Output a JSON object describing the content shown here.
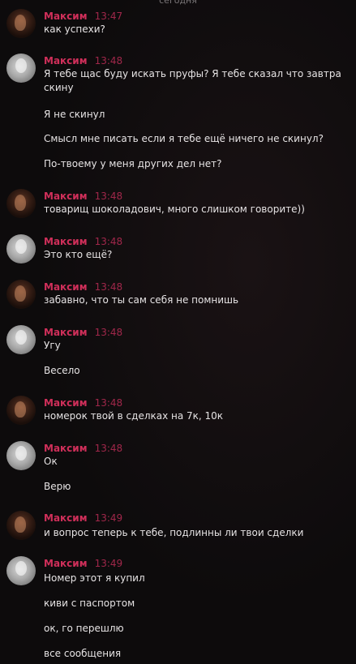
{
  "date_separator": "сегодня",
  "colors": {
    "author": "#d02f5a",
    "time": "#a0274a",
    "text": "#e6e3e4",
    "background": "#0d0b0c"
  },
  "messages": [
    {
      "author": "Максим",
      "time": "13:47",
      "avatar": "dark-portrait",
      "lines": [
        "как успехи?"
      ]
    },
    {
      "author": "Максим",
      "time": "13:48",
      "avatar": "light-portrait",
      "lines": [
        "Я тебе щас буду искать пруфы? Я тебе сказал что завтра",
        "скину",
        "Я не скинул",
        "Смысл мне писать если я тебе ещё ничего не скинул?",
        "По-твоему у меня других дел нет?"
      ]
    },
    {
      "author": "Максим",
      "time": "13:48",
      "avatar": "dark-portrait",
      "lines": [
        "товарищ шоколадович, много слишком говорите))"
      ]
    },
    {
      "author": "Максим",
      "time": "13:48",
      "avatar": "light-portrait",
      "lines": [
        "Это кто ещё?"
      ]
    },
    {
      "author": "Максим",
      "time": "13:48",
      "avatar": "dark-portrait",
      "lines": [
        "забавно, что ты сам себя не помнишь"
      ]
    },
    {
      "author": "Максим",
      "time": "13:48",
      "avatar": "light-portrait",
      "lines": [
        "Угу",
        "Весело"
      ]
    },
    {
      "author": "Максим",
      "time": "13:48",
      "avatar": "dark-portrait",
      "lines": [
        "номерок твой в сделках на 7к, 10к"
      ]
    },
    {
      "author": "Максим",
      "time": "13:48",
      "avatar": "light-portrait",
      "lines": [
        "Ок",
        "Верю"
      ]
    },
    {
      "author": "Максим",
      "time": "13:49",
      "avatar": "dark-portrait",
      "lines": [
        "и вопрос теперь к тебе, подлинны ли твои сделки"
      ]
    },
    {
      "author": "Максим",
      "time": "13:49",
      "avatar": "light-portrait",
      "lines": [
        "Номер этот я купил",
        "киви с паспортом",
        "ок, го перешлю",
        "все сообщения"
      ]
    }
  ]
}
